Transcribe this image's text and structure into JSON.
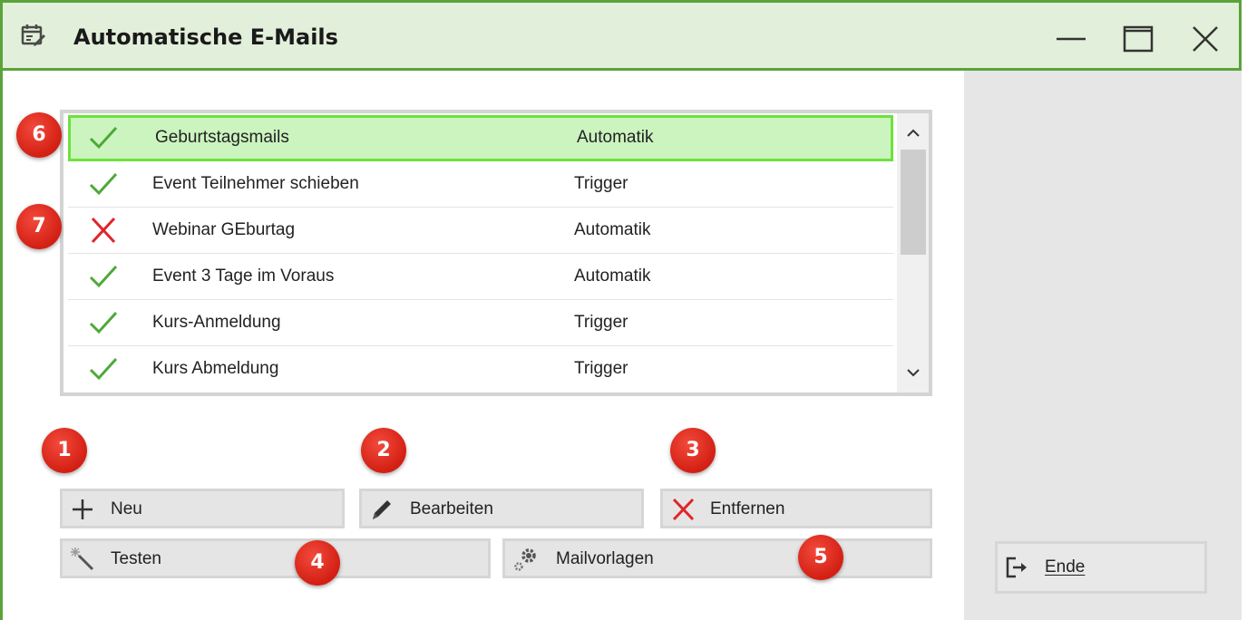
{
  "window": {
    "title": "Automatische E-Mails",
    "title_icon": "calendar-edit-icon",
    "controls": [
      "minimize-icon",
      "maximize-icon",
      "close-icon"
    ]
  },
  "colors": {
    "frame": "#5aa33a",
    "titlebar_bg": "#e2efda",
    "selected_row_bg": "#cbf4bf",
    "selected_row_border": "#6de23c",
    "check_green": "#4ea83a",
    "cross_red": "#e0252a",
    "badge_red": "#d31f14"
  },
  "list": {
    "rows": [
      {
        "status": "active",
        "status_icon": "checkmark-icon",
        "name": "Geburtstagsmails",
        "type": "Automatik",
        "selected": true
      },
      {
        "status": "active",
        "status_icon": "checkmark-icon",
        "name": "Event Teilnehmer schieben",
        "type": "Trigger",
        "selected": false
      },
      {
        "status": "inactive",
        "status_icon": "cross-icon",
        "name": "Webinar GEburtag",
        "type": "Automatik",
        "selected": false
      },
      {
        "status": "active",
        "status_icon": "checkmark-icon",
        "name": "Event 3 Tage im Voraus",
        "type": "Automatik",
        "selected": false
      },
      {
        "status": "active",
        "status_icon": "checkmark-icon",
        "name": "Kurs-Anmeldung",
        "type": "Trigger",
        "selected": false
      },
      {
        "status": "active",
        "status_icon": "checkmark-icon",
        "name": "Kurs Abmeldung",
        "type": "Trigger",
        "selected": false
      }
    ]
  },
  "buttons": {
    "new": "Neu",
    "edit": "Bearbeiten",
    "remove": "Entfernen",
    "test": "Testen",
    "templates": "Mailvorlagen",
    "end": "Ende"
  },
  "badges": {
    "b1": "1",
    "b2": "2",
    "b3": "3",
    "b4": "4",
    "b5": "5",
    "b6": "6",
    "b7": "7"
  }
}
